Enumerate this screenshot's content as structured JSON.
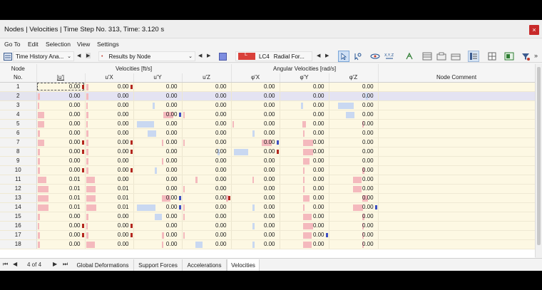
{
  "window": {
    "title": "Nodes | Velocities | Time Step No. 313, Time: 3.120 s",
    "close_glyph": "×"
  },
  "menu": [
    "Go To",
    "Edit",
    "Selection",
    "View",
    "Settings"
  ],
  "toolbar": {
    "analysis_combo": "Time History Ana...",
    "results_combo": "Results by Node",
    "load_case": "LC4",
    "load_case_desc": "Radial For...",
    "load_case_color": "#d9403a",
    "more_glyph": "»"
  },
  "table": {
    "group_headers": {
      "node_no_line1": "Node",
      "node_no_line2": "No.",
      "velocities": "Velocities [ft/s]",
      "angular": "Angular Velocities [rad/s]",
      "comment": "Node Comment"
    },
    "columns": [
      "|u'|",
      "u'X",
      "u'Y",
      "u'Z",
      "φ'X",
      "φ'Y",
      "φ'Z"
    ],
    "rows": [
      {
        "no": "1",
        "v": [
          "0.00",
          "0.00",
          "0.00",
          "0.00",
          "0.00",
          "0.00",
          "0.00"
        ]
      },
      {
        "no": "2",
        "v": [
          "0.00",
          "0.00",
          "0.00",
          "0.00",
          "0.00",
          "0.00",
          "0.00"
        ]
      },
      {
        "no": "3",
        "v": [
          "0.00",
          "0.00",
          "0.00",
          "0.00",
          "0.00",
          "0.00",
          "0.00"
        ]
      },
      {
        "no": "4",
        "v": [
          "0.00",
          "0.00",
          "0.00",
          "0.00",
          "0.00",
          "0.00",
          "0.00"
        ]
      },
      {
        "no": "5",
        "v": [
          "0.00",
          "0.00",
          "0.00",
          "0.00",
          "0.00",
          "0.00",
          "0.00"
        ]
      },
      {
        "no": "6",
        "v": [
          "0.00",
          "0.00",
          "0.00",
          "0.00",
          "0.00",
          "0.00",
          "0.00"
        ]
      },
      {
        "no": "7",
        "v": [
          "0.00",
          "0.00",
          "0.00",
          "0.00",
          "0.00",
          "0.00",
          "0.00"
        ]
      },
      {
        "no": "8",
        "v": [
          "0.00",
          "0.00",
          "0.00",
          "0.00",
          "0.00",
          "0.00",
          "0.00"
        ]
      },
      {
        "no": "9",
        "v": [
          "0.00",
          "0.00",
          "0.00",
          "0.00",
          "0.00",
          "0.00",
          "0.00"
        ]
      },
      {
        "no": "10",
        "v": [
          "0.00",
          "0.00",
          "0.00",
          "0.00",
          "0.00",
          "0.00",
          "0.00"
        ]
      },
      {
        "no": "11",
        "v": [
          "0.01",
          "0.00",
          "0.00",
          "0.00",
          "0.00",
          "0.00",
          "0.00"
        ]
      },
      {
        "no": "12",
        "v": [
          "0.01",
          "0.01",
          "0.00",
          "0.00",
          "0.00",
          "0.00",
          "0.00"
        ]
      },
      {
        "no": "13",
        "v": [
          "0.01",
          "0.01",
          "0.00",
          "0.00",
          "0.00",
          "0.00",
          "0.00"
        ]
      },
      {
        "no": "14",
        "v": [
          "0.01",
          "0.01",
          "0.00",
          "0.00",
          "0.00",
          "0.00",
          "0.00"
        ]
      },
      {
        "no": "15",
        "v": [
          "0.00",
          "0.00",
          "0.00",
          "0.00",
          "0.00",
          "0.00",
          "0.00"
        ]
      },
      {
        "no": "16",
        "v": [
          "0.00",
          "0.00",
          "0.00",
          "0.00",
          "0.00",
          "0.00",
          "0.00"
        ]
      },
      {
        "no": "17",
        "v": [
          "0.00",
          "0.00",
          "0.00",
          "0.00",
          "0.00",
          "0.00",
          "0.00"
        ]
      },
      {
        "no": "18",
        "v": [
          "0.00",
          "0.00",
          "0.00",
          "0.00",
          "0.00",
          "0.00",
          "0.00"
        ]
      }
    ]
  },
  "pager": {
    "first_glyph": "⏮",
    "prev_glyph": "◀",
    "next_glyph": "▶",
    "last_glyph": "⏭",
    "page": "4 of 4"
  },
  "tabs": [
    "Global Deformations",
    "Support Forces",
    "Accelerations",
    "Velocities"
  ],
  "active_tab": "Velocities",
  "colors": {
    "positive_bar": "#f4b9bd",
    "negative_bar": "#c9d8f1",
    "max_marker": "#b3261e",
    "min_marker": "#3d4fc2",
    "selected_row": "#e4e3f2"
  }
}
